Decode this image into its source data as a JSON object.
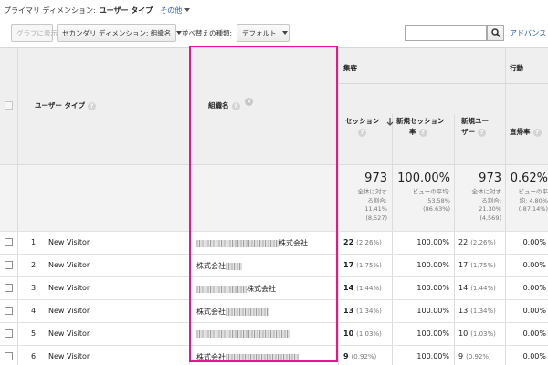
{
  "dimension_bar": {
    "label": "プライマリ ディメンション:",
    "current": "ユーザー タイプ",
    "other": "その他"
  },
  "toolbar": {
    "graph_button": "グラフに表示",
    "secondary_dimension": "セカンダリ ディメンション: 組織名",
    "sort_label": "並べ替えの種類:",
    "sort_value": "デフォルト",
    "search_value": "",
    "advanced_link": "アドバンス"
  },
  "columns": {
    "user_type": "ユーザー タイプ",
    "organization": "組織名",
    "acquisition_group": "集客",
    "behavior_group": "行動",
    "sessions": "セッション",
    "new_sessions_rate_line1": "新規セッション",
    "new_sessions_rate_line2": "率",
    "new_users_line1": "新規ユー",
    "new_users_line2": "ザー",
    "bounce_rate": "直帰率"
  },
  "summary": {
    "sessions": "973",
    "sessions_note": "全体に対す\nる割合:\n11.41%\n(8,527)",
    "new_sessions_rate": "100.00%",
    "new_sessions_note": "ビューの平均:\n53.58%\n(86.63%)",
    "new_users": "973",
    "new_users_note": "全体に対す\nる割合:\n21.30%\n(4,569)",
    "bounce_rate": "0.62%",
    "bounce_note": "ビューの平\n均: 4.80%\n(-87.14%)"
  },
  "rows": [
    {
      "index": "1.",
      "user_type": "New Visitor",
      "org_suffix": "株式会社",
      "sessions": "22",
      "sessions_pct": "(2.26%)",
      "new_rate": "100.00%",
      "new_users": "22",
      "new_users_pct": "(2.26%)",
      "bounce": "0.00%"
    },
    {
      "index": "2.",
      "user_type": "New Visitor",
      "org_prefix": "株式会社",
      "sessions": "17",
      "sessions_pct": "(1.75%)",
      "new_rate": "100.00%",
      "new_users": "17",
      "new_users_pct": "(1.75%)",
      "bounce": "0.00%"
    },
    {
      "index": "3.",
      "user_type": "New Visitor",
      "org_suffix": "株式会社",
      "sessions": "14",
      "sessions_pct": "(1.44%)",
      "new_rate": "100.00%",
      "new_users": "14",
      "new_users_pct": "(1.44%)",
      "bounce": "0.00%"
    },
    {
      "index": "4.",
      "user_type": "New Visitor",
      "org_prefix": "株式会社",
      "sessions": "13",
      "sessions_pct": "(1.34%)",
      "new_rate": "100.00%",
      "new_users": "13",
      "new_users_pct": "(1.34%)",
      "bounce": "0.00%"
    },
    {
      "index": "5.",
      "user_type": "New Visitor",
      "sessions": "10",
      "sessions_pct": "(1.03%)",
      "new_rate": "100.00%",
      "new_users": "10",
      "new_users_pct": "(1.03%)",
      "bounce": "0.00%"
    },
    {
      "index": "6.",
      "user_type": "New Visitor",
      "org_prefix": "株式会社",
      "sessions": "9",
      "sessions_pct": "(0.92%)",
      "new_rate": "100.00%",
      "new_users": "9",
      "new_users_pct": "(0.92%)",
      "bounce": "0.00%"
    }
  ],
  "colors": {
    "highlight": "#e0198f",
    "link": "#2a5db0"
  }
}
